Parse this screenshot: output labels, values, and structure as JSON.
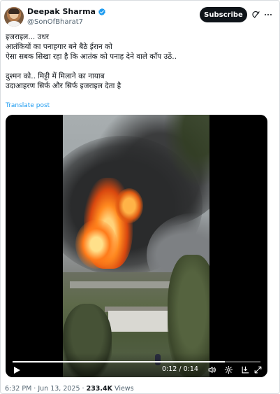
{
  "author": {
    "name": "Deepak Sharma",
    "handle": "@SonOfBharat7",
    "verified_color": "#1d9bf0"
  },
  "header": {
    "subscribe_label": "Subscribe",
    "icons": [
      "grok-icon",
      "more-icon"
    ]
  },
  "tweet": {
    "lines": [
      "इजराइल... उधर",
      "आतंकियों का पनाहगार बने बैठे ईरान को",
      "ऐसा सबक सिखा रहा है कि आतंक को पनाह देने वाले काँप उठें..",
      "",
      "दुश्मन को.. मिट्टी में मिलाने का नायाब",
      "उदाआहरण सिर्फ और सिर्फ इजराइल देता है"
    ],
    "translate_label": "Translate post"
  },
  "video": {
    "current_time": "0:12",
    "separator": " / ",
    "duration": "0:14",
    "progress": 0.857,
    "icons": [
      "play-icon",
      "volume-icon",
      "settings-icon",
      "download-icon",
      "fullscreen-icon"
    ]
  },
  "meta": {
    "time": "6:32 PM",
    "date": "Jun 13, 2025",
    "views_count": "233.4K",
    "views_label": "Views",
    "dot": " · "
  },
  "colors": {
    "accent": "#1d9bf0",
    "text": "#0f1419",
    "muted": "#536471"
  }
}
